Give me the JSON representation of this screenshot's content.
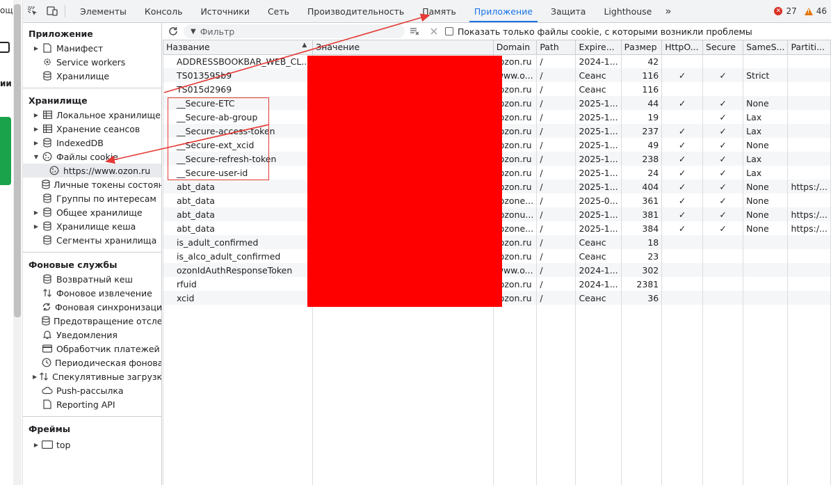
{
  "left_page": {
    "text_top": "ощ",
    "text_mid": "ии"
  },
  "topbar": {
    "tabs": [
      {
        "label": "Элементы",
        "active": false
      },
      {
        "label": "Консоль",
        "active": false
      },
      {
        "label": "Источники",
        "active": false
      },
      {
        "label": "Сеть",
        "active": false
      },
      {
        "label": "Производительность",
        "active": false
      },
      {
        "label": "Память",
        "active": false
      },
      {
        "label": "Приложение",
        "active": true
      },
      {
        "label": "Защита",
        "active": false
      },
      {
        "label": "Lighthouse",
        "active": false
      }
    ],
    "more": "»",
    "errors": "27",
    "warnings": "46",
    "error_color": "#d93025",
    "warning_color": "#e37400",
    "active_color": "#1a73e8"
  },
  "sidebar": {
    "application": {
      "title": "Приложение",
      "items": [
        "Манифест",
        "Service workers",
        "Хранилище"
      ]
    },
    "storage": {
      "title": "Хранилище",
      "items": [
        "Локальное хранилище",
        "Хранение сеансов",
        "IndexedDB",
        "Файлы cookie",
        "https://www.ozon.ru",
        "Личные токены состояния",
        "Группы по интересам",
        "Общее хранилище",
        "Хранилище кеша",
        "Сегменты хранилища"
      ]
    },
    "background": {
      "title": "Фоновые службы",
      "items": [
        "Возвратный кеш",
        "Фоновое извлечение",
        "Фоновая синхронизация",
        "Предотвращение отслежи",
        "Уведомления",
        "Обработчик платежей",
        "Периодическая фоновая с",
        "Спекулятивные загрузки",
        "Push-рассылка",
        "Reporting API"
      ]
    },
    "frames": {
      "title": "Фреймы",
      "items": [
        "top"
      ]
    }
  },
  "toolbar": {
    "filter_placeholder": "Фильтр",
    "checkbox_label": "Показать только файлы cookie, с которыми возникли проблемы"
  },
  "table": {
    "columns": [
      "Название",
      "Значение",
      "Domain",
      "Path",
      "Expire...",
      "Размер",
      "HttpO...",
      "Secure",
      "SameS...",
      "Partiti..."
    ],
    "rows": [
      [
        "ADDRESSBOOKBAR_WEB_CL...",
        "",
        ".ozon.ru",
        "/",
        "2024-1...",
        "42",
        "",
        "",
        "",
        ""
      ],
      [
        "TS013595b9",
        "",
        "www.o...",
        "/",
        "Сеанс",
        "116",
        "✓",
        "✓",
        "Strict",
        ""
      ],
      [
        "TS015d2969",
        "",
        ".ozon.ru",
        "/",
        "Сеанс",
        "116",
        "",
        "",
        "",
        ""
      ],
      [
        "__Secure-ETC",
        "",
        ".ozon.ru",
        "/",
        "2025-1...",
        "44",
        "✓",
        "✓",
        "None",
        ""
      ],
      [
        "__Secure-ab-group",
        "",
        ".ozon.ru",
        "/",
        "2025-1...",
        "19",
        "",
        "✓",
        "Lax",
        ""
      ],
      [
        "__Secure-access-token",
        "",
        ".ozon.ru",
        "/",
        "2025-1...",
        "237",
        "✓",
        "✓",
        "Lax",
        ""
      ],
      [
        "__Secure-ext_xcid",
        "",
        ".ozon.ru",
        "/",
        "2025-1...",
        "49",
        "✓",
        "✓",
        "None",
        ""
      ],
      [
        "__Secure-refresh-token",
        "",
        ".ozon.ru",
        "/",
        "2025-1...",
        "238",
        "✓",
        "✓",
        "Lax",
        ""
      ],
      [
        "__Secure-user-id",
        "",
        ".ozon.ru",
        "/",
        "2025-1...",
        "24",
        "✓",
        "✓",
        "Lax",
        ""
      ],
      [
        "abt_data",
        "",
        ".ozon.ru",
        "/",
        "2025-1...",
        "404",
        "✓",
        "✓",
        "None",
        "https:/..."
      ],
      [
        "abt_data",
        "",
        ".ozone...",
        "/",
        "2025-0...",
        "361",
        "✓",
        "✓",
        "None",
        ""
      ],
      [
        "abt_data",
        "",
        ".ozonu...",
        "/",
        "2025-1...",
        "381",
        "✓",
        "✓",
        "None",
        "https:/..."
      ],
      [
        "abt_data",
        "",
        ".ozone...",
        "/",
        "2025-1...",
        "384",
        "✓",
        "✓",
        "None",
        "https:/..."
      ],
      [
        "is_adult_confirmed",
        "",
        ".ozon.ru",
        "/",
        "Сеанс",
        "18",
        "",
        "",
        "",
        ""
      ],
      [
        "is_alco_adult_confirmed",
        "",
        ".ozon.ru",
        "/",
        "Сеанс",
        "23",
        "",
        "",
        "",
        ""
      ],
      [
        "ozonIdAuthResponseToken",
        "",
        "www.o...",
        "/",
        "2024-1...",
        "302",
        "",
        "",
        "",
        ""
      ],
      [
        "rfuid",
        "",
        ".ozon.ru",
        "/",
        "2024-1...",
        "2381",
        "",
        "",
        "",
        ""
      ],
      [
        "xcid",
        "",
        ".ozon.ru",
        "/",
        "Сеанс",
        "36",
        "",
        "",
        "",
        ""
      ]
    ]
  },
  "annotations": {
    "color": "#e53935",
    "redaction_color": "#ff0000"
  }
}
